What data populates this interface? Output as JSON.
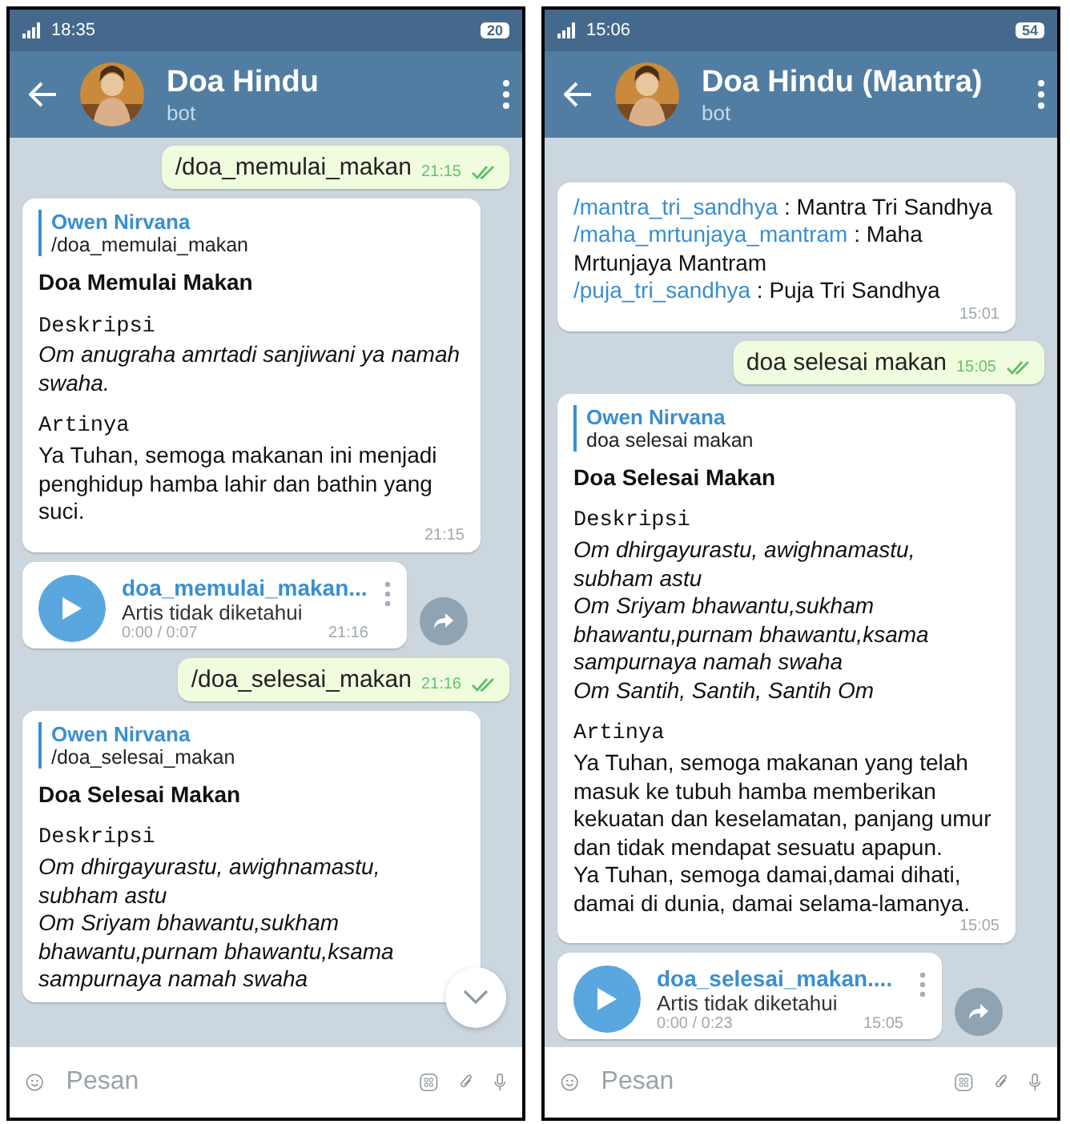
{
  "phones": [
    {
      "status": {
        "time": "18:35",
        "battery": "20"
      },
      "header": {
        "title": "Doa Hindu",
        "subtitle": "bot"
      },
      "scroll_down": true,
      "input": {
        "placeholder": "Pesan"
      },
      "messages": [
        {
          "kind": "outgoing",
          "text": "/doa_memulai_makan",
          "time": "21:15",
          "read": true
        },
        {
          "kind": "incoming",
          "reply": {
            "author": "Owen Nirvana",
            "text": "/doa_memulai_makan"
          },
          "blocks": [
            {
              "kind": "bold",
              "text": "Doa Memulai Makan"
            },
            {
              "kind": "gap"
            },
            {
              "kind": "mono",
              "text": "Deskripsi"
            },
            {
              "kind": "italic",
              "text": "Om anugraha amrtadi sanjiwani ya namah swaha."
            },
            {
              "kind": "gap"
            },
            {
              "kind": "mono",
              "text": "Artinya"
            },
            {
              "kind": "plain",
              "text": "Ya Tuhan, semoga makanan ini menjadi penghidup hamba lahir dan bathin yang suci."
            }
          ],
          "time": "21:15"
        },
        {
          "kind": "audio",
          "title": "doa_memulai_makan...",
          "artist": "Artis tidak diketahui",
          "duration": "0:00 / 0:07",
          "time": "21:16"
        },
        {
          "kind": "outgoing",
          "text": "/doa_selesai_makan",
          "time": "21:16",
          "read": true
        },
        {
          "kind": "incoming",
          "reply": {
            "author": "Owen Nirvana",
            "text": "/doa_selesai_makan"
          },
          "blocks": [
            {
              "kind": "bold",
              "text": "Doa Selesai Makan"
            },
            {
              "kind": "gap"
            },
            {
              "kind": "mono",
              "text": "Deskripsi"
            },
            {
              "kind": "italic",
              "text": "Om dhirgayurastu, awighnamastu, subham astu"
            },
            {
              "kind": "italic",
              "text": "Om Sriyam bhawantu,sukham bhawantu,purnam bhawantu,ksama sampurnaya namah swaha"
            }
          ]
        }
      ]
    },
    {
      "status": {
        "time": "15:06",
        "battery": "54"
      },
      "header": {
        "title": "Doa Hindu (Mantra)",
        "subtitle": "bot"
      },
      "scroll_down": false,
      "input": {
        "placeholder": "Pesan"
      },
      "messages": [
        {
          "kind": "incoming",
          "blocks": [
            {
              "kind": "command",
              "command": "/mantra_tri_sandhya",
              "text": " : Mantra Tri Sandhya"
            },
            {
              "kind": "command",
              "command": "/maha_mrtunjaya_mantram",
              "text": " : Maha Mrtunjaya Mantram"
            },
            {
              "kind": "command",
              "command": "/puja_tri_sandhya",
              "text": " : Puja Tri Sandhya"
            }
          ],
          "time": "15:01"
        },
        {
          "kind": "outgoing",
          "text": "doa selesai makan",
          "time": "15:05",
          "read": true
        },
        {
          "kind": "incoming",
          "reply": {
            "author": "Owen Nirvana",
            "text": "doa selesai makan"
          },
          "blocks": [
            {
              "kind": "bold",
              "text": "Doa Selesai Makan"
            },
            {
              "kind": "gap"
            },
            {
              "kind": "mono",
              "text": "Deskripsi"
            },
            {
              "kind": "italic",
              "text": "Om dhirgayurastu, awighnamastu, subham astu"
            },
            {
              "kind": "italic",
              "text": "Om Sriyam bhawantu,sukham bhawantu,purnam bhawantu,ksama sampurnaya namah swaha"
            },
            {
              "kind": "italic",
              "text": "Om Santih, Santih, Santih Om"
            },
            {
              "kind": "gap"
            },
            {
              "kind": "mono",
              "text": "Artinya"
            },
            {
              "kind": "plain",
              "text": "Ya Tuhan, semoga makanan yang telah masuk ke tubuh hamba memberikan kekuatan dan keselamatan, panjang umur dan tidak mendapat sesuatu apapun."
            },
            {
              "kind": "plain",
              "text": "Ya Tuhan, semoga damai,damai dihati, damai di dunia, damai selama-lamanya."
            }
          ],
          "time": "15:05"
        },
        {
          "kind": "audio",
          "title": "doa_selesai_makan....",
          "artist": "Artis tidak diketahui",
          "duration": "0:00 / 0:23",
          "time": "15:05"
        }
      ]
    }
  ]
}
